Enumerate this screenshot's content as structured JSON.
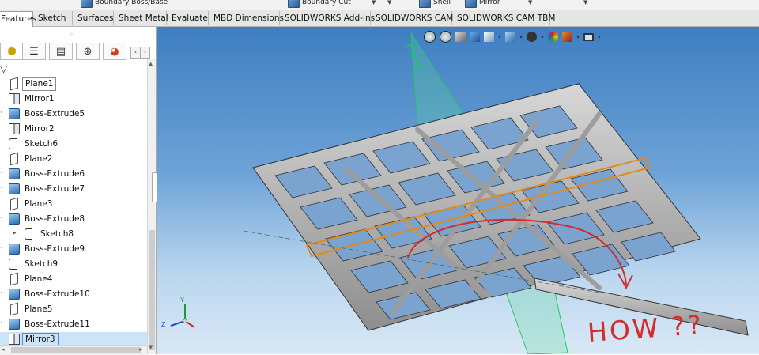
{
  "ribbon": {
    "items": [
      {
        "label": "Boundary Boss/Base",
        "icon": "boundary-boss-icon"
      },
      {
        "label": "Boundary Cut",
        "icon": "boundary-cut-icon"
      },
      {
        "label": "Shell",
        "icon": "shell-icon"
      },
      {
        "label": "Mirror",
        "icon": "mirror-icon"
      }
    ]
  },
  "tabs": [
    {
      "label": "Features",
      "active": true
    },
    {
      "label": "Sketch"
    },
    {
      "label": "Surfaces"
    },
    {
      "label": "Sheet Metal"
    },
    {
      "label": "Evaluate"
    },
    {
      "label": "MBD Dimensions"
    },
    {
      "label": "SOLIDWORKS Add-Ins"
    },
    {
      "label": "SOLIDWORKS CAM"
    },
    {
      "label": "SOLIDWORKS CAM TBM"
    }
  ],
  "manager_tabs": [
    "featuremanager-icon",
    "propertymanager-icon",
    "configurationmanager-icon",
    "dimxpert-icon",
    "display-manager-icon"
  ],
  "tree": [
    {
      "label": "Plane1",
      "icon": "plane",
      "boxed": true
    },
    {
      "label": "Mirror1",
      "icon": "mirror"
    },
    {
      "label": "Boss-Extrude5",
      "icon": "feature",
      "expand": true
    },
    {
      "label": "Mirror2",
      "icon": "mirror"
    },
    {
      "label": "Sketch6",
      "icon": "sketch"
    },
    {
      "label": "Plane2",
      "icon": "plane"
    },
    {
      "label": "Boss-Extrude6",
      "icon": "feature",
      "expand": true
    },
    {
      "label": "Boss-Extrude7",
      "icon": "feature",
      "expand": true
    },
    {
      "label": "Plane3",
      "icon": "plane"
    },
    {
      "label": "Boss-Extrude8",
      "icon": "feature",
      "expand": true
    },
    {
      "label": "Sketch8",
      "icon": "sketch",
      "indent": true,
      "expand": true
    },
    {
      "label": "Boss-Extrude9",
      "icon": "feature",
      "expand": true
    },
    {
      "label": "Sketch9",
      "icon": "sketch"
    },
    {
      "label": "Plane4",
      "icon": "plane"
    },
    {
      "label": "Boss-Extrude10",
      "icon": "feature",
      "expand": true
    },
    {
      "label": "Plane5",
      "icon": "plane"
    },
    {
      "label": "Boss-Extrude11",
      "icon": "feature",
      "expand": true
    },
    {
      "label": "Mirror3",
      "icon": "mirror",
      "selected": true
    }
  ],
  "viewport": {
    "plane_label": "Plane1",
    "annotation": "HOW ??",
    "triad_axes": [
      "Y",
      "Z"
    ],
    "colors": {
      "annotation": "#d42b2b",
      "plane": "#1fcc5c",
      "selection": "#e08a1e"
    }
  }
}
